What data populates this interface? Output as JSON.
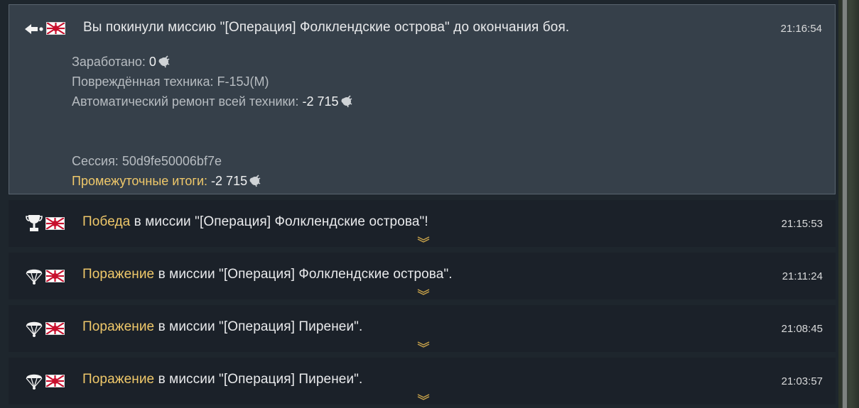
{
  "colors": {
    "accent": "#efc86a",
    "text": "#e9eaec",
    "muted": "#b7bcc1",
    "card_bg": "#1b2129",
    "expanded_bg": "#36404a"
  },
  "expanded": {
    "icon": "leave-mission-icon",
    "flag": "japan-flag-icon",
    "message": "Вы покинули миссию \"[Операция] Фолклендские острова\" до окончания боя.",
    "time": "21:16:54",
    "earned_label": "Заработано: ",
    "earned_value": "0",
    "damaged_label": "Повреждённая техника: ",
    "damaged_value": "F-15J(M)",
    "repair_label": "Автоматический ремонт всей техники: ",
    "repair_value": "-2 715",
    "session_label": "Сессия: ",
    "session_value": "50d9fe50006bf7e",
    "subtotal_label": "Промежуточные итоги: ",
    "subtotal_value": "-2 715",
    "currency_icon": "silver-lion-icon"
  },
  "rows": [
    {
      "icon": "trophy-icon",
      "flag": "japan-flag-icon",
      "result": "Победа",
      "rest": " в миссии \"[Операция] Фолклендские острова\"!",
      "time": "21:15:53"
    },
    {
      "icon": "parachute-icon",
      "flag": "japan-flag-icon",
      "result": "Поражение",
      "rest": " в миссии \"[Операция] Фолклендские острова\".",
      "time": "21:11:24"
    },
    {
      "icon": "parachute-icon",
      "flag": "japan-flag-icon",
      "result": "Поражение",
      "rest": " в миссии \"[Операция] Пиренеи\".",
      "time": "21:08:45"
    },
    {
      "icon": "parachute-icon",
      "flag": "japan-flag-icon",
      "result": "Поражение",
      "rest": " в миссии \"[Операция] Пиренеи\".",
      "time": "21:03:57"
    }
  ]
}
